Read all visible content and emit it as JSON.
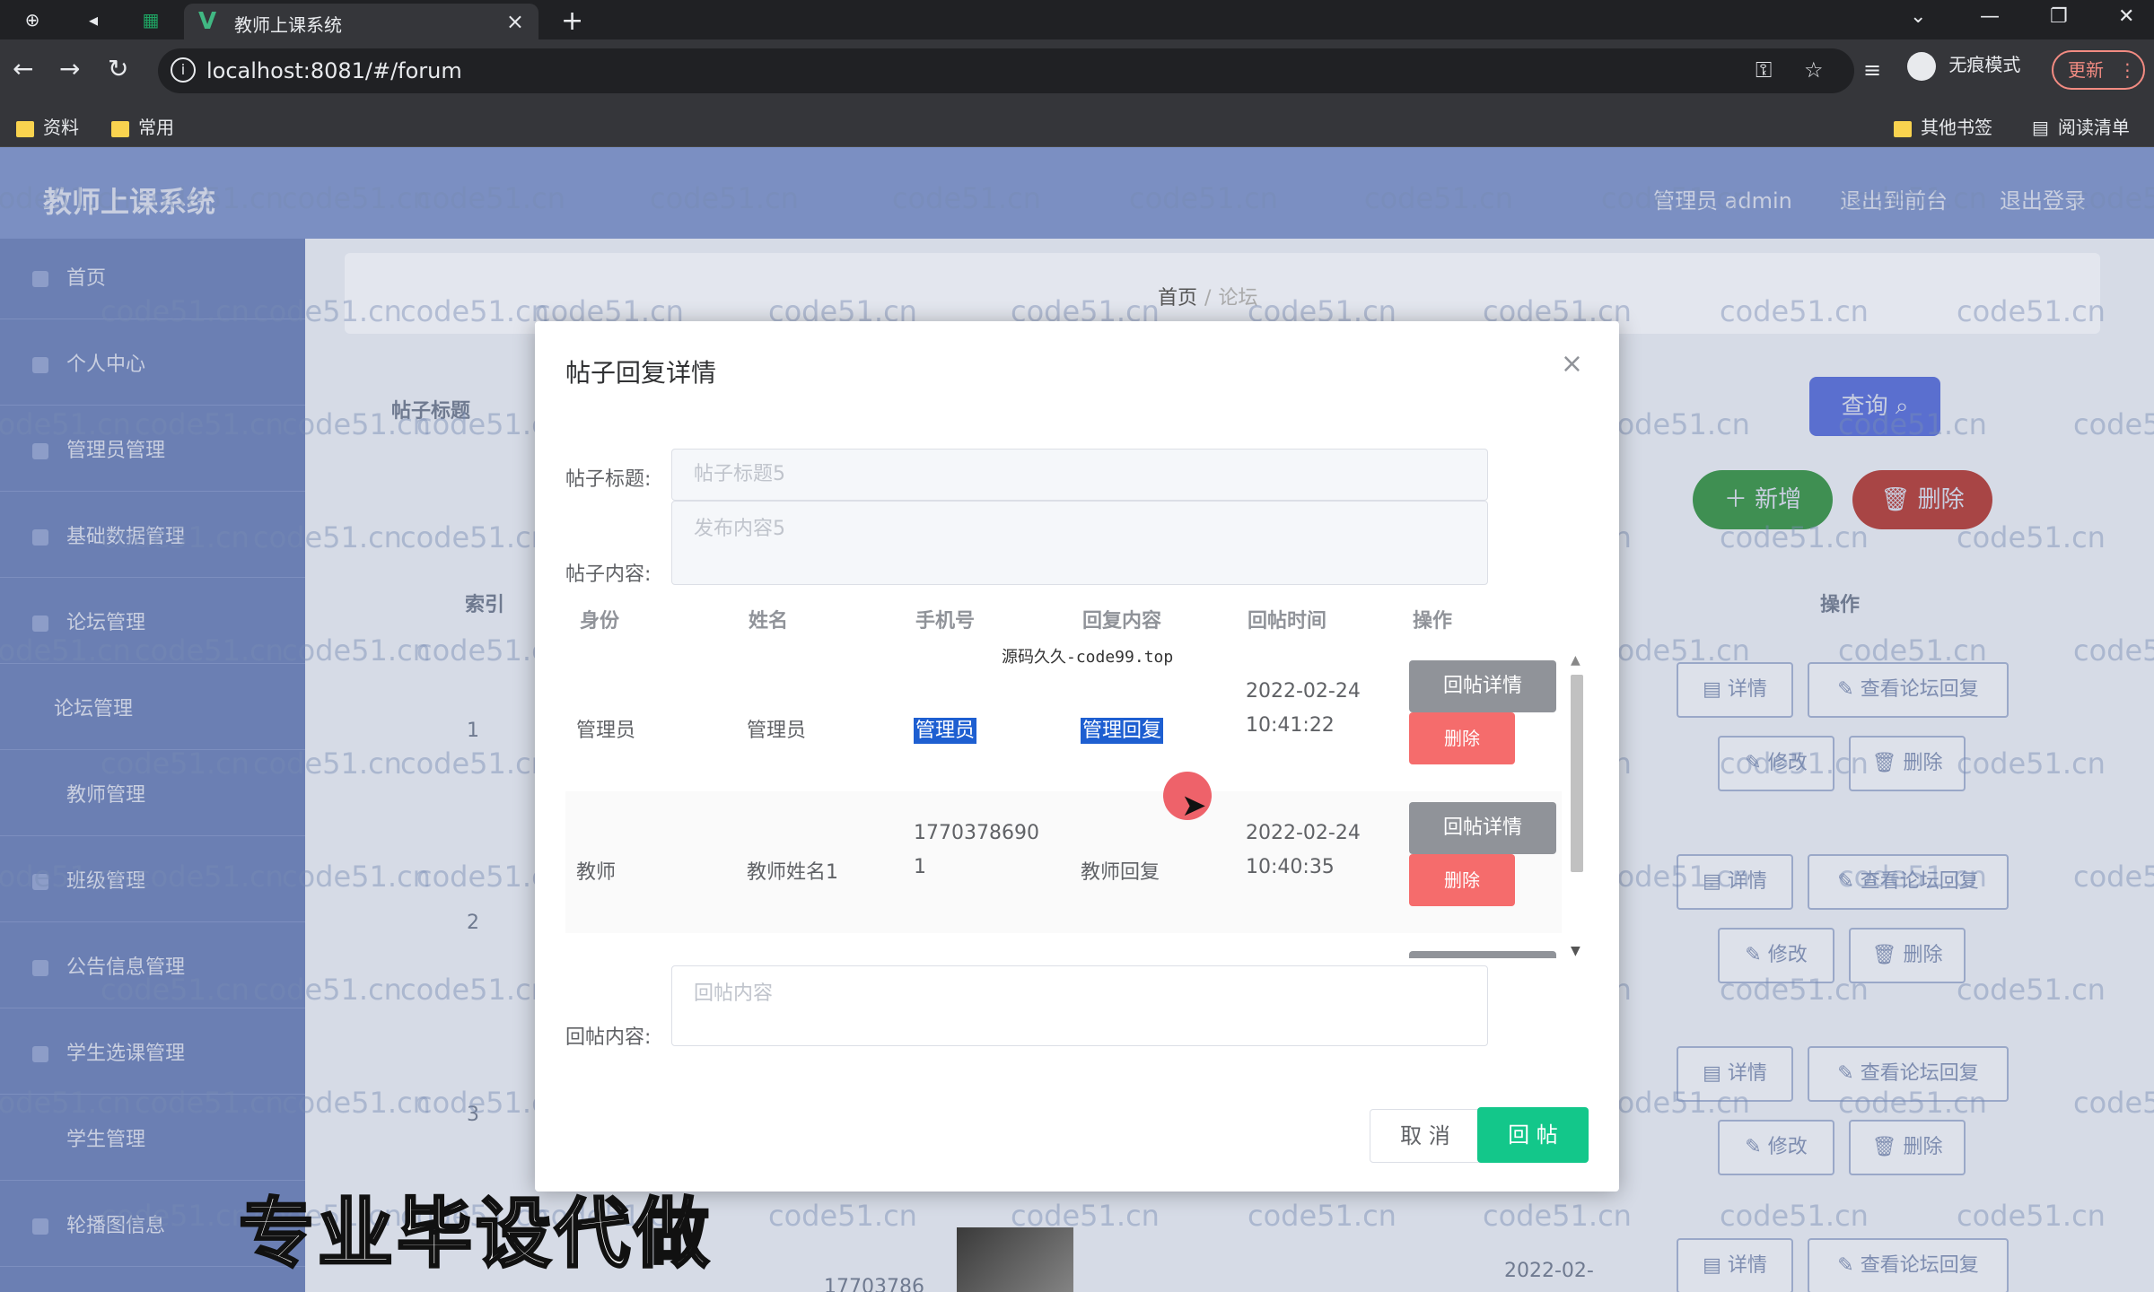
{
  "browser": {
    "tab_title": "教师上课系统",
    "url": "localhost:8081/#/forum",
    "incognito_label": "无痕模式",
    "update_label": "更新",
    "bookmarks": [
      "资料",
      "常用"
    ],
    "other_bookmarks": "其他书签",
    "reading_list": "阅读清单"
  },
  "app": {
    "logo": "教师上课系统",
    "header_links": [
      "管理员 admin",
      "退出到前台",
      "退出登录"
    ],
    "sidebar": [
      "首页",
      "个人中心",
      "管理员管理",
      "基础数据管理",
      "论坛管理",
      "论坛管理",
      "教师管理",
      "班级管理",
      "公告信息管理",
      "学生选课管理",
      "学生管理",
      "轮播图信息"
    ],
    "breadcrumb": {
      "home": "首页",
      "current": "论坛"
    },
    "search_button": "查询",
    "add_button": "新增",
    "delete_button": "删除",
    "search_label": "帖子标题",
    "col_index": "索引",
    "col_action": "操作",
    "row_indices": [
      "1",
      "2",
      "3"
    ],
    "row_buttons": {
      "detail": "详情",
      "view_replies": "查看论坛回复",
      "edit": "修改",
      "delete": "删除"
    },
    "partial_phone": "17703786",
    "partial_date": "2022-02-"
  },
  "watermark_text": "code51.cn",
  "modal": {
    "title": "帖子回复详情",
    "post_title_label": "帖子标题:",
    "post_title_value": "帖子标题5",
    "post_content_label": "帖子内容:",
    "post_content_value": "发布内容5",
    "headers": [
      "身份",
      "姓名",
      "手机号",
      "回复内容",
      "回帖时间",
      "操作"
    ],
    "source_watermark": "源码久久-code99.top",
    "rows": [
      {
        "identity": "管理员",
        "name": "管理员",
        "phone": "管理员",
        "content": "管理回复",
        "date": "2022-02-24",
        "time": "10:41:22",
        "detail_btn": "回帖详情",
        "delete_btn": "删除"
      },
      {
        "identity": "教师",
        "name": "教师姓名1",
        "phone": "1770378690",
        "phone_wrap": "1",
        "content": "教师回复",
        "date": "2022-02-24",
        "time": "10:40:35",
        "detail_btn": "回帖详情",
        "delete_btn": "删除"
      }
    ],
    "reply_label": "回帖内容:",
    "reply_placeholder": "回帖内容",
    "cancel_button": "取 消",
    "submit_button": "回 帖"
  },
  "overlay_caption": "专业毕设代做",
  "colors": {
    "primary_green": "#13c78a",
    "danger": "#f56c6c",
    "info": "#909399",
    "highlight": "#1e5fd1"
  }
}
